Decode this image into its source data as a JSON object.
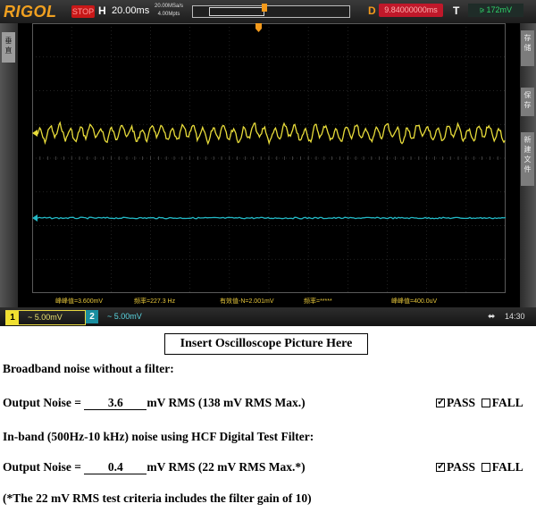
{
  "scope": {
    "brand": "RIGOL",
    "run_state": "STOP",
    "horizontal_label": "H",
    "timebase": "20.00ms",
    "sample_rate": "20.00MSa/s",
    "memory_depth": "4.00Mpts",
    "delay_label": "D",
    "delay_value": "9.84000000ms",
    "trigger_label": "T",
    "trigger_level": "172mV",
    "left_tab": "垂直",
    "right_tabs": [
      "存储",
      "保存",
      "新建文件"
    ],
    "measurements": [
      "峰峰值=3.600mV",
      "频率=227.3 Hz",
      "有效值-N=2.001mV",
      "频率=*****",
      "峰峰值=400.0uV"
    ],
    "ch1": {
      "number": "1",
      "scale": "5.00mV",
      "color": "#e8dc3a"
    },
    "ch2": {
      "number": "2",
      "scale": "5.00mV",
      "color": "#23b9c6"
    },
    "usb_icon": "usb-icon",
    "time": "14:30"
  },
  "caption": "Insert Oscilloscope Picture Here",
  "section1": {
    "heading": "Broadband noise without a filter:",
    "prefix": "Output Noise = ",
    "value": "3.6",
    "suffix": "mV RMS (138 mV RMS Max.)",
    "pass_label": "PASS",
    "fail_label": "FALL",
    "pass_checked": true
  },
  "section2": {
    "heading": "In-band (500Hz-10 kHz) noise using HCF Digital Test Filter:",
    "prefix": "Output Noise = ",
    "value": "0.4",
    "suffix": "mV RMS (22 mV RMS Max.*)",
    "pass_label": "PASS",
    "fail_label": "FALL",
    "pass_checked": true
  },
  "footnote": "(*The 22 mV RMS test criteria includes the filter gain of 10)"
}
